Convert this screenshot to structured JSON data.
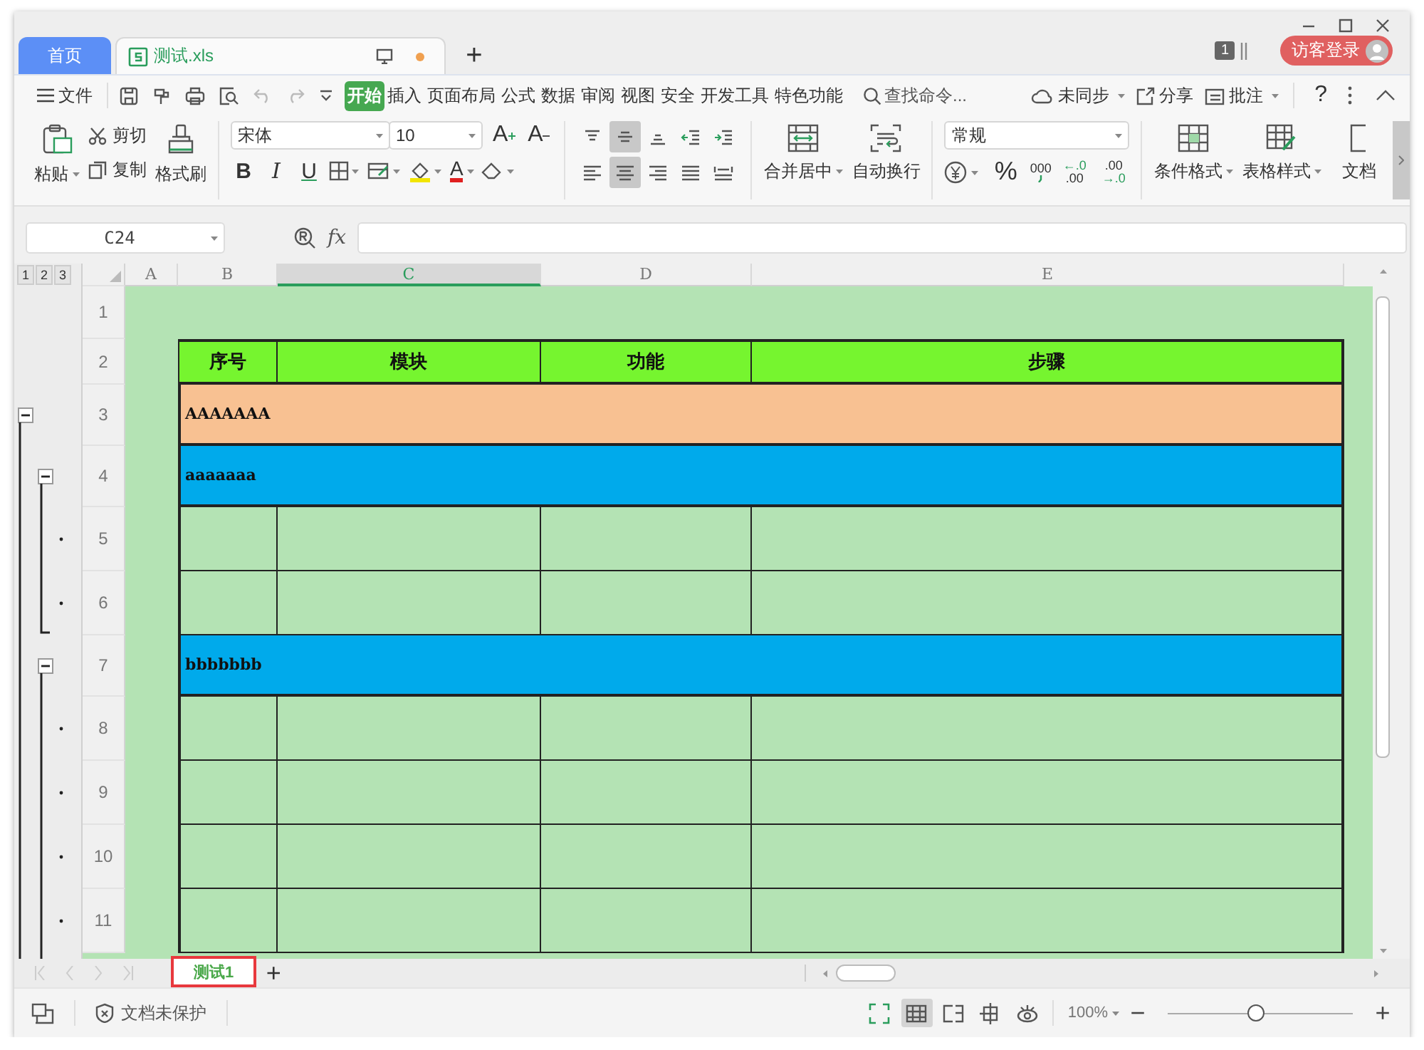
{
  "title_bar": {
    "tabs": [
      {
        "kind": "home",
        "label": "首页",
        "selected": false
      },
      {
        "kind": "document",
        "label": "测试.xls",
        "selected": true,
        "unsaved": true
      }
    ],
    "new_tab": "+",
    "window_count": "1",
    "login": "访客登录"
  },
  "menu_bar": {
    "file": "文件",
    "tabs": [
      {
        "label": "开始",
        "selected": true
      },
      {
        "label": "插入",
        "selected": false
      },
      {
        "label": "页面布局",
        "selected": false
      },
      {
        "label": "公式",
        "selected": false
      },
      {
        "label": "数据",
        "selected": false
      },
      {
        "label": "审阅",
        "selected": false
      },
      {
        "label": "视图",
        "selected": false
      },
      {
        "label": "安全",
        "selected": false
      },
      {
        "label": "开发工具",
        "selected": false
      },
      {
        "label": "特色功能",
        "selected": false
      }
    ],
    "search": "查找命令...",
    "sync": "未同步",
    "share": "分享",
    "comment": "批注",
    "help": "?"
  },
  "ribbon": {
    "paste": "粘贴",
    "cut": "剪切",
    "copy": "复制",
    "format_painter": "格式刷",
    "font_name": "宋体",
    "font_size": "10",
    "grow_font": "A",
    "shrink_font": "A",
    "font_styles": [
      {
        "kind": "bold",
        "label": "B"
      },
      {
        "kind": "italic",
        "label": "I"
      },
      {
        "kind": "underline",
        "label": "U"
      }
    ],
    "font_color": "A",
    "align_top_row": [
      {
        "kind": "top",
        "selected": false
      },
      {
        "kind": "middle",
        "selected": true
      },
      {
        "kind": "bottom",
        "selected": false
      },
      {
        "kind": "outdent",
        "selected": false
      },
      {
        "kind": "indent",
        "selected": false
      }
    ],
    "align_bottom_row": [
      {
        "kind": "left",
        "selected": false
      },
      {
        "kind": "center",
        "selected": true
      },
      {
        "kind": "right",
        "selected": false
      },
      {
        "kind": "justify",
        "selected": false
      },
      {
        "kind": "distributed",
        "selected": false
      }
    ],
    "merge": "合并居中",
    "wrap": "自动换行",
    "number_format": "常规",
    "percent": "%",
    "thousands": "000",
    "increase_decimal": [
      "←.0",
      ".00"
    ],
    "decrease_decimal": [
      ".00",
      "→.0"
    ],
    "conditional_format": "条件格式",
    "table_style": "表格样式",
    "document": "文档"
  },
  "formula_bar": {
    "cell_ref": "C24",
    "fx": "fx"
  },
  "sheet": {
    "outline_levels": [
      "1",
      "2",
      "3"
    ],
    "columns": [
      {
        "label": "A",
        "selected": false
      },
      {
        "label": "B",
        "selected": false
      },
      {
        "label": "C",
        "selected": true
      },
      {
        "label": "D",
        "selected": false
      },
      {
        "label": "E",
        "selected": false
      }
    ],
    "rows": [
      {
        "number": "1",
        "kind": "spacer"
      },
      {
        "number": "2",
        "kind": "header",
        "color": "#76f52f",
        "cells": [
          "序号",
          "模块",
          "功能",
          "步骤"
        ]
      },
      {
        "number": "3",
        "kind": "group",
        "color": "#f8c192",
        "text": "AAAAAAA",
        "outline": {
          "kind": "outer_collapse",
          "expanded": true
        }
      },
      {
        "number": "4",
        "kind": "group",
        "color": "#00aaeb",
        "text": "aaaaaaa",
        "outline": {
          "kind": "inner_collapse",
          "expanded": true
        }
      },
      {
        "number": "5",
        "kind": "detail",
        "outline": {
          "kind": "detail"
        }
      },
      {
        "number": "6",
        "kind": "detail",
        "outline": {
          "kind": "detail"
        }
      },
      {
        "number": "7",
        "kind": "group",
        "color": "#00aaeb",
        "text": "bbbbbbb",
        "outline": {
          "kind": "inner_collapse",
          "expanded": true
        }
      },
      {
        "number": "8",
        "kind": "detail",
        "outline": {
          "kind": "detail"
        }
      },
      {
        "number": "9",
        "kind": "detail",
        "outline": {
          "kind": "detail"
        }
      },
      {
        "number": "10",
        "kind": "detail",
        "outline": {
          "kind": "detail"
        }
      },
      {
        "number": "11",
        "kind": "detail",
        "outline": {
          "kind": "detail"
        }
      }
    ]
  },
  "sheet_tabs": {
    "tabs": [
      {
        "label": "测试1",
        "selected": true,
        "highlighted": true
      }
    ],
    "add": "+"
  },
  "status_bar": {
    "protection": "文档未保护",
    "view_modes": [
      {
        "kind": "fullscreen",
        "selected": false
      },
      {
        "kind": "normal",
        "selected": true
      },
      {
        "kind": "page_break",
        "selected": false
      },
      {
        "kind": "layout",
        "selected": false
      },
      {
        "kind": "eye_care",
        "selected": false
      }
    ],
    "zoom": "100%",
    "zoom_out": "−",
    "zoom_in": "+",
    "zoom_slider": {
      "level": 0.48
    }
  }
}
